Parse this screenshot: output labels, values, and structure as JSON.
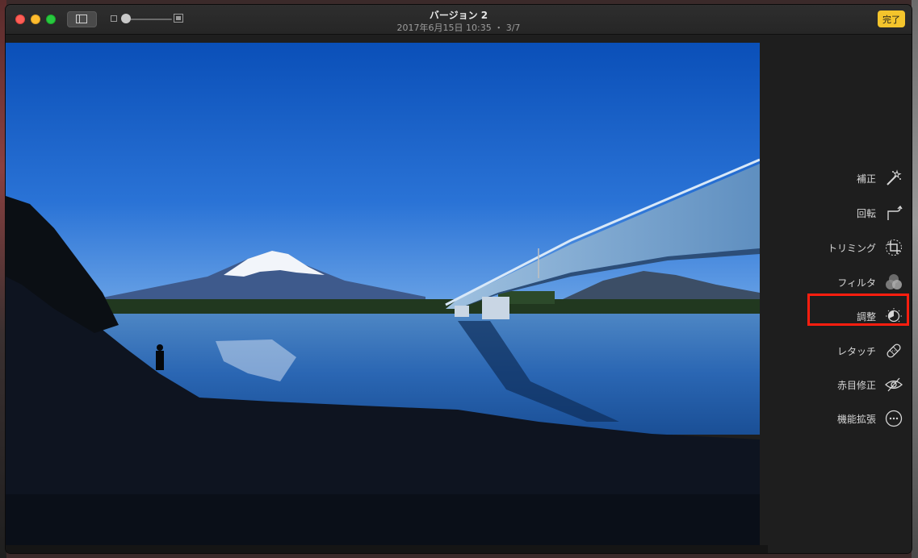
{
  "window": {
    "title": "バージョン 2",
    "subtitle": "2017年6月15日 10:35 ・ 3/7",
    "done_label": "完了"
  },
  "toolbar": {
    "sidebar_toggle_icon": "sidebar-icon",
    "zoom_min_icon": "small-photo-icon",
    "zoom_max_icon": "large-photo-icon",
    "zoom_level": 0.1
  },
  "tools": [
    {
      "label": "補正",
      "icon": "magic-wand-icon"
    },
    {
      "label": "回転",
      "icon": "rotate-icon"
    },
    {
      "label": "トリミング",
      "icon": "crop-icon"
    },
    {
      "label": "フィルタ",
      "icon": "filters-icon"
    },
    {
      "label": "調整",
      "icon": "adjust-dial-icon",
      "highlighted": true
    },
    {
      "label": "レタッチ",
      "icon": "bandage-icon"
    },
    {
      "label": "赤目修正",
      "icon": "red-eye-icon"
    },
    {
      "label": "機能拡張",
      "icon": "more-icon"
    }
  ],
  "colors": {
    "accent_done": "#f3c42c",
    "highlight_box": "#ff1e0f",
    "panel_bg": "#1e1e1e"
  }
}
